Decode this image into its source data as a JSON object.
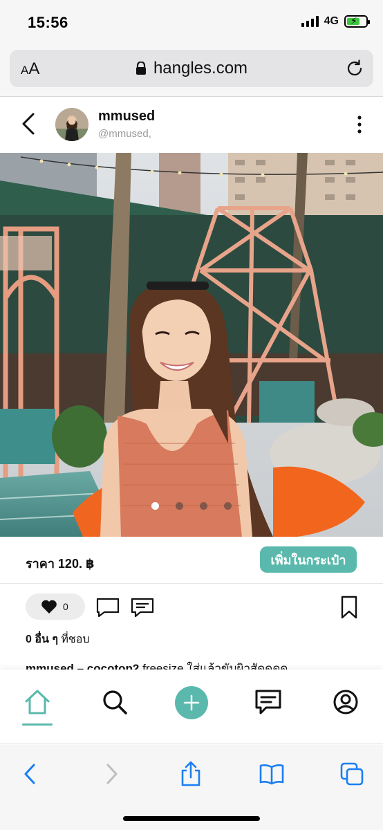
{
  "status_bar": {
    "time": "15:56",
    "network": "4G",
    "icons": [
      "signal-icon",
      "battery-charging-icon"
    ],
    "battery_color": "#3ec53e"
  },
  "browser": {
    "text_size_label": "AA",
    "url": "hangles.com",
    "icons": [
      "lock-icon",
      "reload-icon"
    ]
  },
  "post": {
    "username": "mmused",
    "handle": "@mmused,",
    "price": "ราคา 120. ฿",
    "add_to_cart_label": "เพิ่มในกระเป๋า",
    "like_count": "0",
    "likes_count_bold": "0 อื่น ๆ",
    "likes_suffix": " ที่ชอบ",
    "caption_user": "mmused – cocotop2",
    "caption_text": " freesize ใส่แล้วขับผิวสัดดดด",
    "carousel": {
      "total": 4,
      "active": 1
    },
    "accent_color": "#5ab9ac"
  },
  "app_nav": {
    "items": [
      "home-icon",
      "search-icon",
      "add-icon",
      "messages-icon",
      "profile-icon"
    ],
    "active": "home-icon"
  },
  "safari_toolbar": {
    "items": [
      "back-icon",
      "forward-icon",
      "share-icon",
      "bookmarks-icon",
      "tabs-icon"
    ],
    "tint_color": "#1a7ef2"
  }
}
